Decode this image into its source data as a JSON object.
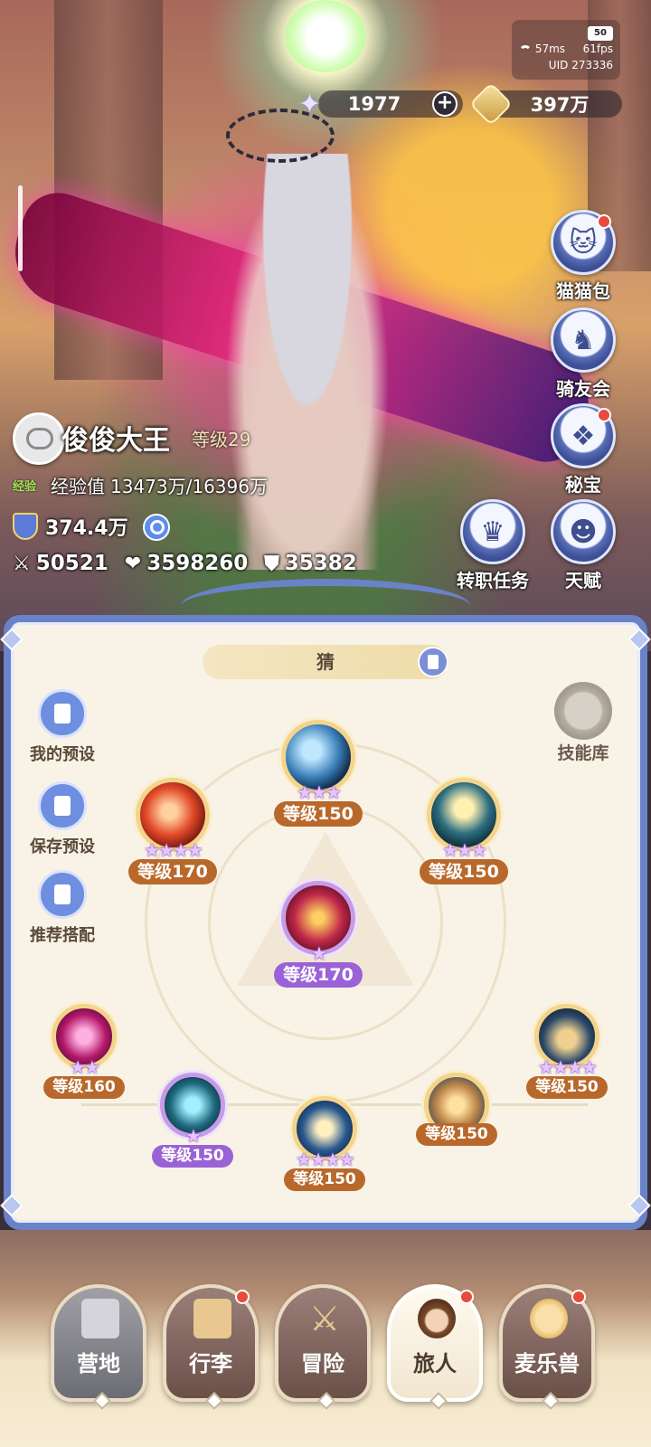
{
  "status": {
    "battery": "50",
    "ping": "57ms",
    "fps": "61fps",
    "uid_label": "UID",
    "uid": "273336"
  },
  "currency": {
    "gems": "1977",
    "gold": "397万"
  },
  "side_menu": [
    {
      "label": "猫猫包",
      "icon": "cat-bag-icon",
      "badge": true
    },
    {
      "label": "骑友会",
      "icon": "horse-icon",
      "badge": false
    },
    {
      "label": "秘宝",
      "icon": "treasure-chest-icon",
      "badge": true
    },
    {
      "label": "天赋",
      "icon": "brain-head-icon",
      "badge": false
    }
  ],
  "job_quest_label": "转职任务",
  "player": {
    "name": "俊俊大王",
    "level": "等级29",
    "exp_tag": "经验",
    "exp_label": "经验值",
    "exp_value": "13473万/16396万",
    "power": "374.4万",
    "attack": "50521",
    "hp": "3598260",
    "defense": "35382"
  },
  "panel": {
    "pet_name": "猜",
    "tools": [
      {
        "label": "我的预设",
        "icon": "preset-cards-icon"
      },
      {
        "label": "保存预设",
        "icon": "save-floppy-icon"
      },
      {
        "label": "推荐搭配",
        "icon": "recommend-icon"
      }
    ],
    "skill_lib": "技能库",
    "skills": [
      {
        "level": "等级150",
        "stars": "★★★",
        "color": "gold",
        "art": "#3a7fb8"
      },
      {
        "level": "等级170",
        "stars": "★★★★",
        "color": "gold",
        "art": "#c8341e"
      },
      {
        "level": "等级150",
        "stars": "★★★",
        "color": "gold",
        "art": "#2c6e80"
      },
      {
        "level": "等级170",
        "stars": "★",
        "color": "purple",
        "art": "#a0203c"
      },
      {
        "level": "等级160",
        "stars": "★★",
        "color": "gold",
        "art": "#b4186a"
      },
      {
        "level": "等级150",
        "stars": "★",
        "color": "purple",
        "art": "#1e6a80"
      },
      {
        "level": "等级150",
        "stars": "★★★★",
        "color": "gold",
        "art": "#2a5a90"
      },
      {
        "level": "等级150",
        "stars": "",
        "color": "gold",
        "art": "#3a6a9a"
      },
      {
        "level": "等级150",
        "stars": "★★★★",
        "color": "gold",
        "art": "#2c4a6a"
      }
    ]
  },
  "bottom_nav": [
    {
      "label": "营地",
      "badge": false,
      "active": false
    },
    {
      "label": "行李",
      "badge": true,
      "active": false
    },
    {
      "label": "冒险",
      "badge": false,
      "active": false
    },
    {
      "label": "旅人",
      "badge": true,
      "active": true
    },
    {
      "label": "麦乐兽",
      "badge": true,
      "active": false
    }
  ]
}
